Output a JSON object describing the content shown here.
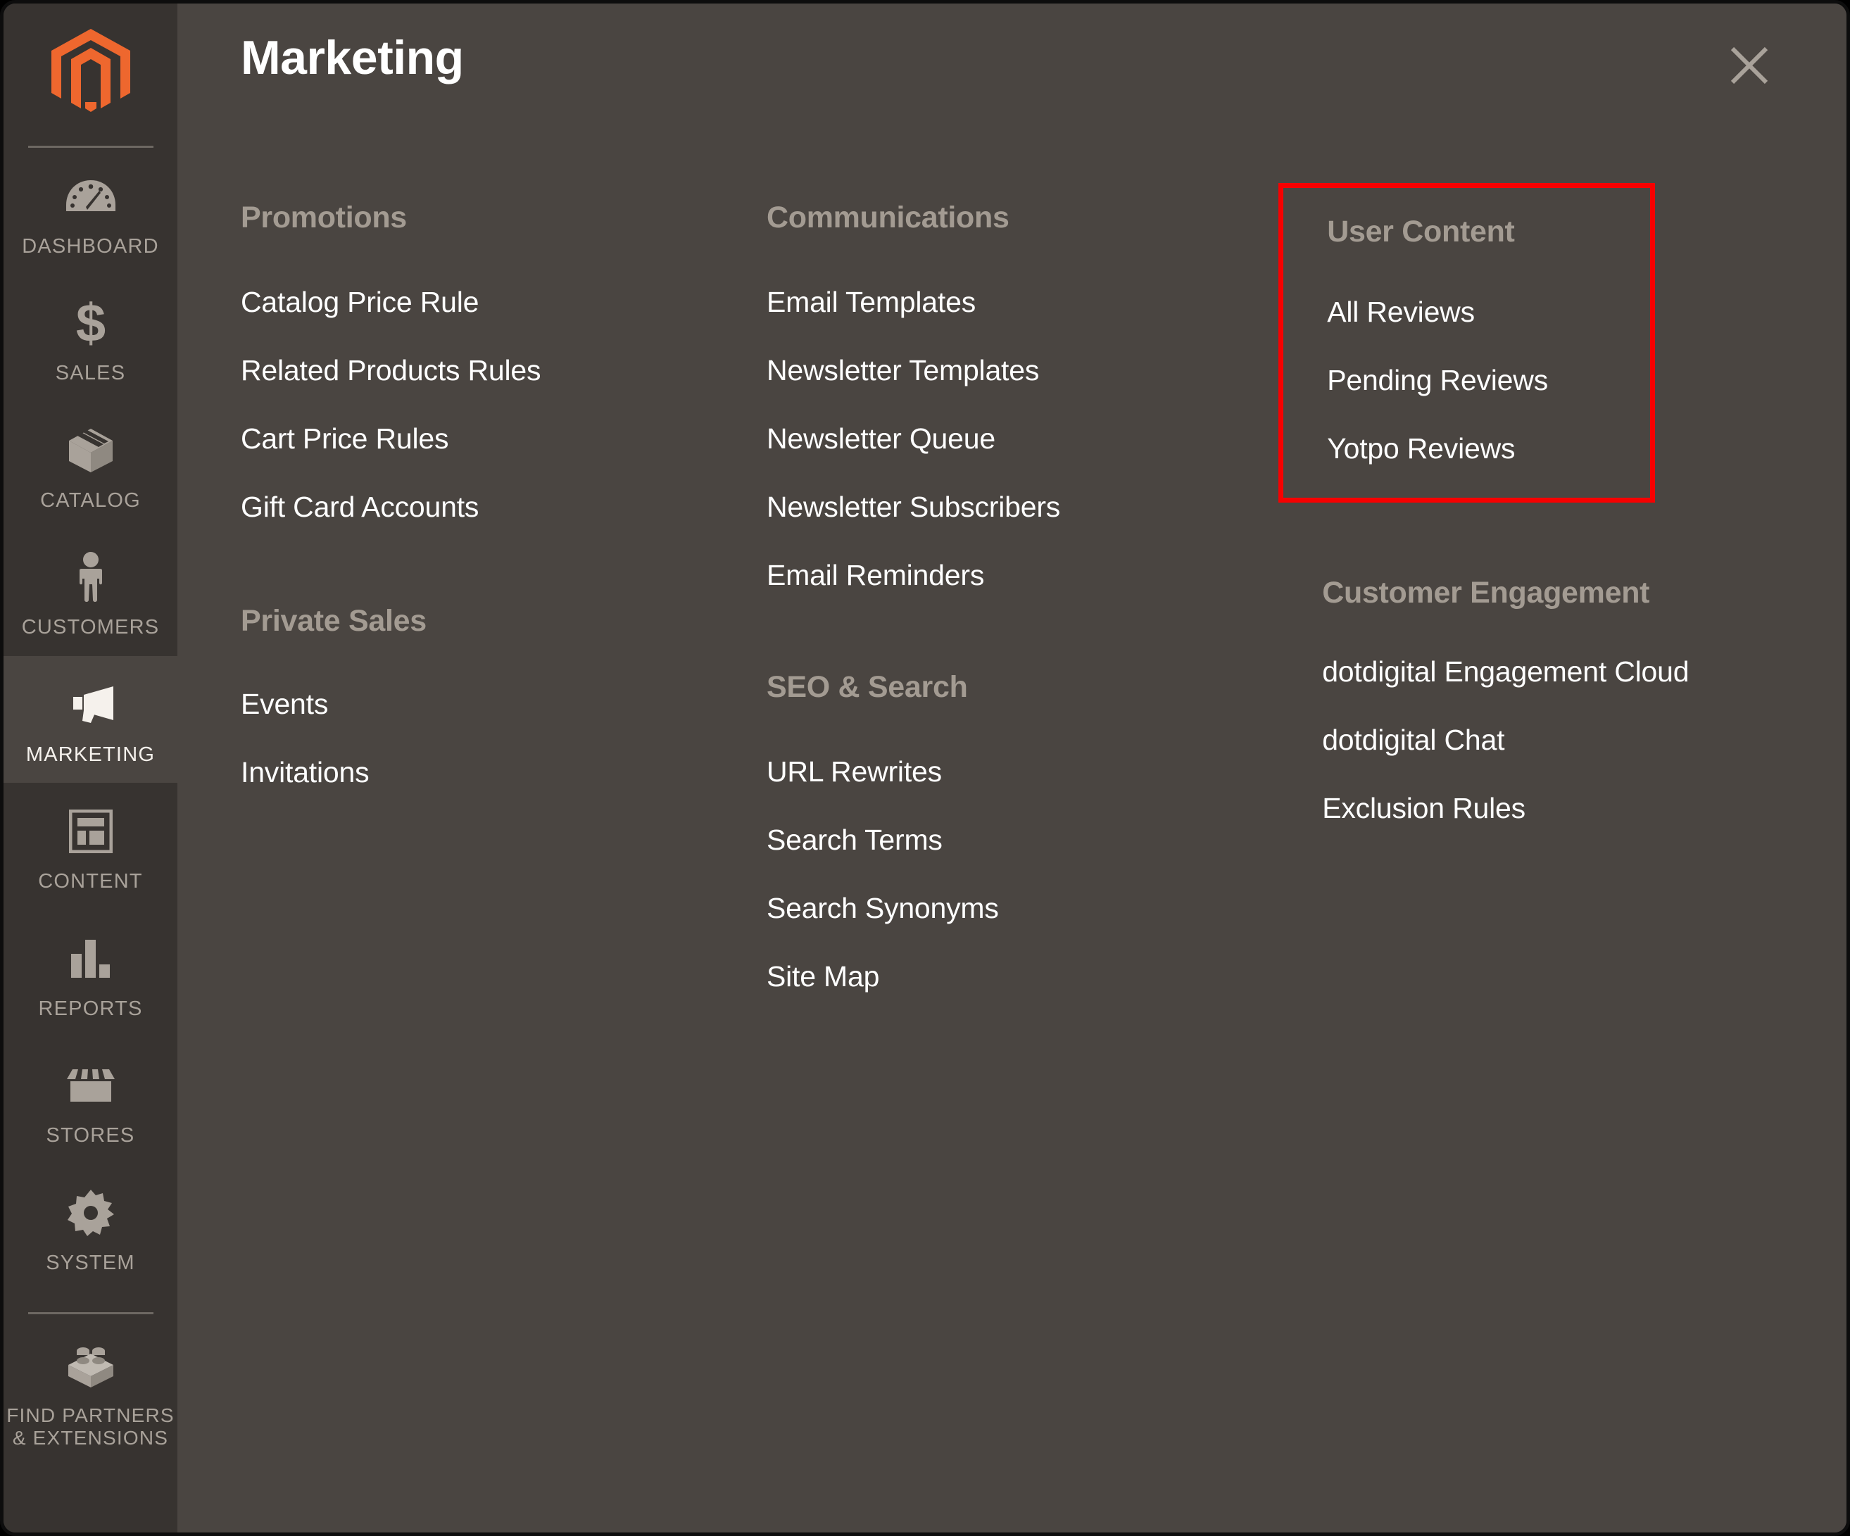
{
  "app": {
    "brand_icon": "magento-logo-icon",
    "accent_color": "#ee672e",
    "sidebar_bg": "#373330",
    "panel_bg": "#4A4541",
    "highlight_color": "#f70000"
  },
  "sidebar": {
    "items": [
      {
        "label": "DASHBOARD",
        "icon": "gauge-icon",
        "active": false
      },
      {
        "label": "SALES",
        "icon": "dollar-icon",
        "active": false
      },
      {
        "label": "CATALOG",
        "icon": "box-icon",
        "active": false
      },
      {
        "label": "CUSTOMERS",
        "icon": "person-icon",
        "active": false
      },
      {
        "label": "MARKETING",
        "icon": "megaphone-icon",
        "active": true
      },
      {
        "label": "CONTENT",
        "icon": "layout-icon",
        "active": false
      },
      {
        "label": "REPORTS",
        "icon": "bar-chart-icon",
        "active": false
      },
      {
        "label": "STORES",
        "icon": "storefront-icon",
        "active": false
      },
      {
        "label": "SYSTEM",
        "icon": "gear-icon",
        "active": false
      },
      {
        "label": "FIND PARTNERS\n& EXTENSIONS",
        "label_line1": "FIND PARTNERS",
        "label_line2": "& EXTENSIONS",
        "icon": "lego-brick-icon",
        "active": false
      }
    ]
  },
  "panel": {
    "title": "Marketing",
    "close_icon": "close-icon",
    "groups": [
      {
        "id": "promotions",
        "title": "Promotions",
        "items": [
          "Catalog Price Rule",
          "Related Products Rules",
          "Cart Price Rules",
          "Gift Card Accounts"
        ]
      },
      {
        "id": "private_sales",
        "title": "Private Sales",
        "items": [
          "Events",
          "Invitations"
        ]
      },
      {
        "id": "communications",
        "title": "Communications",
        "items": [
          "Email Templates",
          "Newsletter Templates",
          "Newsletter Queue",
          "Newsletter Subscribers",
          "Email Reminders"
        ]
      },
      {
        "id": "seo_search",
        "title": "SEO & Search",
        "items": [
          "URL Rewrites",
          "Search Terms",
          "Search Synonyms",
          "Site Map"
        ]
      },
      {
        "id": "user_content",
        "title": "User Content",
        "highlighted": true,
        "items": [
          "All Reviews",
          "Pending Reviews",
          "Yotpo Reviews"
        ]
      },
      {
        "id": "customer_engagement",
        "title": "Customer Engagement",
        "items": [
          "dotdigital Engagement Cloud",
          "dotdigital Chat",
          "Exclusion Rules"
        ]
      }
    ]
  }
}
